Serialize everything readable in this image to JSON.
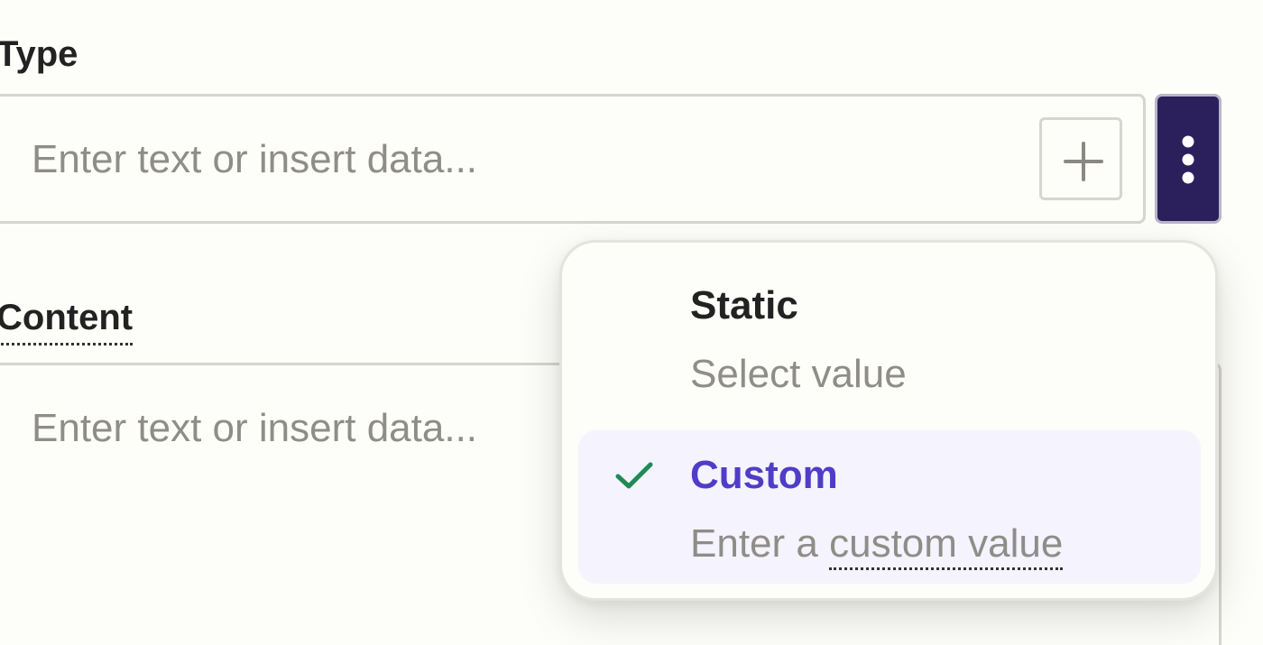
{
  "fields": {
    "type": {
      "label": "Type",
      "placeholder": "Enter text or insert data..."
    },
    "content": {
      "label": "Content",
      "placeholder": "Enter text or insert data..."
    }
  },
  "icons": {
    "plus": "plus-icon",
    "more": "vertical-ellipsis-icon",
    "check": "checkmark-icon"
  },
  "menu": {
    "options": [
      {
        "title": "Static",
        "description": "Select value",
        "selected": false
      },
      {
        "title": "Custom",
        "description_prefix": "Enter a",
        "description_link": "custom value",
        "selected": true
      }
    ]
  },
  "colors": {
    "background": "#fdfdf9",
    "border": "#d6d5cf",
    "menu_button": "#2b1f5c",
    "accent": "#4f3dc8",
    "selected_background": "#f4f3fe",
    "check": "#1f8a55",
    "placeholder": "#8f8d88"
  }
}
